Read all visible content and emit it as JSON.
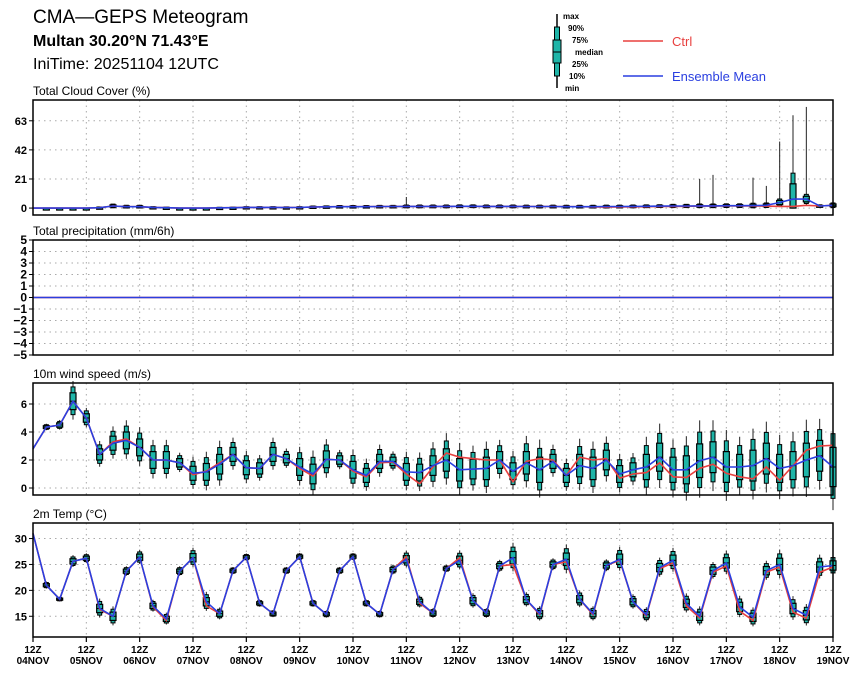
{
  "header": {
    "title": "CMA—GEPS Meteogram",
    "location": "Multan 30.20°N 71.43°E",
    "init_time": "IniTime: 20251104 12UTC"
  },
  "legend": {
    "box_labels": [
      "max",
      "90%",
      "75%",
      "median",
      "25%",
      "10%",
      "min"
    ],
    "ctrl_label": "Ctrl",
    "mean_label": "Ensemble Mean",
    "ctrl_color": "#e8403f",
    "mean_color": "#2a3fe0",
    "box_color": "#1fb5a8"
  },
  "chart_data": {
    "type": "line",
    "x_steps_hours": 6,
    "x_count": 61,
    "x_tick_labels": [
      [
        "12Z",
        "04NOV"
      ],
      [
        "12Z",
        "05NOV"
      ],
      [
        "12Z",
        "06NOV"
      ],
      [
        "12Z",
        "07NOV"
      ],
      [
        "12Z",
        "08NOV"
      ],
      [
        "12Z",
        "09NOV"
      ],
      [
        "12Z",
        "10NOV"
      ],
      [
        "12Z",
        "11NOV"
      ],
      [
        "12Z",
        "12NOV"
      ],
      [
        "12Z",
        "13NOV"
      ],
      [
        "12Z",
        "14NOV"
      ],
      [
        "12Z",
        "15NOV"
      ],
      [
        "12Z",
        "16NOV"
      ],
      [
        "12Z",
        "17NOV"
      ],
      [
        "12Z",
        "18NOV"
      ],
      [
        "12Z",
        "19NOV"
      ]
    ],
    "panels": [
      {
        "title": "Total Cloud Cover (%)",
        "ylim": [
          -5,
          78
        ],
        "yticks": [
          0,
          21,
          42,
          63
        ],
        "mean": [
          0,
          0,
          0,
          0,
          0,
          0.3,
          1.5,
          1,
          1,
          0.5,
          0.3,
          0,
          0,
          0,
          0.2,
          0.3,
          0.5,
          0.5,
          0.5,
          0.4,
          0.5,
          0.8,
          0.9,
          1,
          1,
          1,
          1.1,
          1.1,
          1.2,
          1.2,
          1.2,
          1.2,
          1.3,
          1.3,
          1.2,
          1.2,
          1.2,
          1.1,
          1.1,
          1.1,
          1,
          1,
          1,
          1.1,
          1.1,
          1.2,
          1.3,
          1.4,
          1.5,
          1.5,
          1.6,
          1.6,
          1.7,
          1.7,
          1.8,
          2,
          4,
          6.5,
          6.5,
          1.5,
          2
        ],
        "ctrl": [
          0,
          0,
          0,
          0,
          0,
          0.3,
          1.5,
          1,
          1,
          0.5,
          0.3,
          0,
          0,
          0,
          0.2,
          0.3,
          0.5,
          0.5,
          0.5,
          0.4,
          0.5,
          0.8,
          0.9,
          1,
          1,
          1,
          1.1,
          1.1,
          1.2,
          1.2,
          1.2,
          1.2,
          1.3,
          1.3,
          1.2,
          1.2,
          1.2,
          1.1,
          1.1,
          1.1,
          1,
          1,
          0.8,
          0.7,
          0.8,
          0.9,
          1,
          1.1,
          1.2,
          1.3,
          1.4,
          1.4,
          1.5,
          1.5,
          1.5,
          1.4,
          1.2,
          1.2,
          2,
          1.5,
          2
        ],
        "spread": [
          0,
          0,
          0,
          0,
          0,
          0.3,
          0.8,
          0.6,
          0.6,
          0.3,
          0.2,
          0,
          0,
          0,
          0.2,
          0.2,
          0.3,
          0.3,
          0.3,
          0.3,
          0.3,
          0.4,
          0.4,
          0.5,
          0.5,
          0.5,
          0.5,
          0.5,
          0.6,
          0.6,
          0.6,
          0.6,
          0.6,
          0.6,
          0.6,
          0.6,
          0.6,
          0.6,
          0.6,
          0.6,
          0.6,
          0.6,
          0.6,
          0.6,
          0.6,
          0.6,
          0.6,
          0.6,
          0.7,
          0.7,
          0.8,
          0.8,
          0.8,
          0.8,
          1,
          1,
          1.5,
          11,
          2,
          0.5,
          1
        ],
        "max": [
          0,
          0,
          0,
          0,
          0,
          0.5,
          2,
          1.5,
          1.5,
          0.8,
          0.5,
          0,
          0,
          0,
          0.4,
          0.5,
          0.8,
          0.8,
          0.8,
          0.7,
          0.8,
          1.2,
          1.3,
          1.5,
          1.5,
          1.5,
          1.6,
          1.6,
          8,
          1.8,
          1.8,
          1.8,
          1.9,
          1.9,
          1.8,
          1.8,
          1.8,
          1.7,
          1.7,
          1.7,
          1.6,
          1.6,
          1.6,
          1.7,
          1.7,
          1.8,
          1.9,
          2,
          2.2,
          2.2,
          21,
          24,
          2.5,
          2.5,
          22,
          16,
          48,
          67,
          73,
          2,
          3
        ]
      },
      {
        "title": "Total precipitation (mm/6h)",
        "ylim": [
          -5,
          5
        ],
        "yticks": [
          -5,
          -4,
          -3,
          -2,
          -1,
          0,
          1,
          2,
          3,
          4,
          5
        ],
        "mean": [
          0,
          0,
          0,
          0,
          0,
          0,
          0,
          0,
          0,
          0,
          0,
          0,
          0,
          0,
          0,
          0,
          0,
          0,
          0,
          0,
          0,
          0,
          0,
          0,
          0,
          0,
          0,
          0,
          0,
          0,
          0,
          0,
          0,
          0,
          0,
          0,
          0,
          0,
          0,
          0,
          0,
          0,
          0,
          0,
          0,
          0,
          0,
          0,
          0,
          0,
          0,
          0,
          0,
          0,
          0,
          0,
          0,
          0,
          0,
          0,
          0
        ],
        "ctrl": [
          0,
          0,
          0,
          0,
          0,
          0,
          0,
          0,
          0,
          0,
          0,
          0,
          0,
          0,
          0,
          0,
          0,
          0,
          0,
          0,
          0,
          0,
          0,
          0,
          0,
          0,
          0,
          0,
          0,
          0,
          0,
          0,
          0,
          0,
          0,
          0,
          0,
          0,
          0,
          0,
          0,
          0,
          0,
          0,
          0,
          0,
          0,
          0,
          0,
          0,
          0,
          0,
          0,
          0,
          0,
          0,
          0,
          0,
          0,
          0,
          0
        ]
      },
      {
        "title": "10m wind speed (m/s)",
        "ylim": [
          -0.5,
          7.5
        ],
        "yticks": [
          0,
          2,
          4,
          6
        ],
        "mean": [
          2.8,
          4.35,
          4.5,
          6.2,
          5.0,
          2.4,
          3.2,
          3.4,
          2.9,
          2.0,
          2.0,
          1.8,
          1.05,
          1.15,
          1.7,
          2.4,
          1.45,
          1.4,
          2.4,
          2.1,
          1.5,
          1.0,
          2.05,
          2.0,
          1.3,
          0.9,
          1.9,
          1.9,
          1.15,
          1.1,
          1.6,
          2.0,
          1.3,
          1.35,
          1.4,
          2.0,
          1.2,
          1.8,
          1.3,
          1.9,
          0.9,
          1.6,
          1.4,
          2.0,
          1.0,
          1.3,
          1.5,
          2.2,
          1.3,
          1.3,
          1.95,
          2.2,
          1.5,
          1.5,
          1.6,
          2.1,
          1.4,
          1.6,
          2.0,
          2.3,
          1.5
        ],
        "ctrl": [
          2.8,
          4.35,
          4.5,
          6.2,
          5.0,
          2.4,
          3.3,
          3.5,
          2.9,
          2.0,
          2.0,
          1.8,
          0.95,
          1.2,
          1.8,
          2.4,
          1.45,
          1.4,
          2.4,
          2.1,
          1.4,
          0.85,
          2.05,
          2.0,
          1.2,
          0.8,
          1.8,
          1.85,
          1.0,
          0.3,
          1.5,
          2.5,
          2.2,
          2.1,
          2.0,
          2.0,
          0.45,
          1.9,
          2.1,
          2.0,
          0.9,
          2.2,
          2.0,
          2.1,
          0.7,
          1.0,
          1.1,
          1.8,
          0.8,
          0.75,
          1.4,
          1.7,
          1.05,
          0.8,
          0.65,
          1.5,
          0.55,
          1.6,
          2.7,
          3.0,
          3.05
        ],
        "spread": [
          0,
          0.1,
          0.15,
          0.6,
          0.3,
          0.4,
          0.5,
          0.6,
          0.6,
          0.6,
          0.6,
          0.3,
          0.5,
          0.6,
          0.7,
          0.5,
          0.5,
          0.4,
          0.5,
          0.3,
          0.6,
          0.7,
          0.6,
          0.3,
          0.6,
          0.5,
          0.5,
          0.3,
          0.6,
          0.6,
          0.7,
          0.8,
          0.8,
          0.7,
          0.8,
          0.6,
          0.6,
          0.8,
          0.9,
          0.5,
          0.5,
          0.8,
          0.8,
          0.7,
          0.6,
          0.5,
          0.9,
          1.0,
          0.9,
          1.0,
          1.2,
          1.1,
          1.1,
          0.9,
          1.1,
          1.1,
          1.0,
          1.0,
          1.2,
          1.1,
          1.4
        ]
      },
      {
        "title": "2m Temp (°C)",
        "ylim": [
          11,
          33
        ],
        "yticks": [
          15,
          20,
          25,
          30
        ],
        "mean": [
          31,
          21,
          18.3,
          25.6,
          26.2,
          16.5,
          15,
          23.7,
          26.4,
          17,
          14.5,
          23.7,
          26.3,
          17.8,
          15.5,
          23.8,
          26.4,
          17.5,
          15.5,
          23.8,
          26.5,
          17.5,
          15.4,
          23.8,
          26.5,
          17.5,
          15.4,
          24,
          26,
          17.8,
          15.6,
          24.2,
          25.8,
          18,
          15.6,
          24.7,
          26.3,
          18.2,
          15.5,
          25,
          26,
          18.3,
          15.5,
          24.8,
          26,
          17.8,
          15.3,
          24.4,
          25.8,
          17.5,
          15,
          23.8,
          25.3,
          16.8,
          14.8,
          23.8,
          25,
          16.5,
          15.2,
          24.5,
          24.8
        ],
        "ctrl": [
          31,
          21,
          18.3,
          25.6,
          26.2,
          16.3,
          15,
          23.7,
          26.4,
          16.8,
          14.2,
          23.7,
          26.3,
          17.0,
          15.5,
          23.8,
          26.4,
          17.5,
          15.5,
          23.8,
          26.5,
          17.5,
          15.4,
          23.8,
          26.5,
          17.5,
          15.4,
          24,
          26.5,
          17.5,
          15.6,
          24.2,
          26.3,
          18,
          15.6,
          24.7,
          25.0,
          18.2,
          15.3,
          25,
          25.5,
          18.3,
          15.3,
          24.8,
          25.8,
          17.8,
          15.1,
          24.2,
          25.3,
          17.0,
          14.7,
          23.5,
          24.7,
          16.0,
          14.2,
          23.5,
          24.5,
          15.8,
          14.6,
          23.5,
          24.5
        ],
        "spread": [
          0,
          0.3,
          0.2,
          0.5,
          0.4,
          0.8,
          0.8,
          0.4,
          0.6,
          0.5,
          0.5,
          0.4,
          0.8,
          0.8,
          0.5,
          0.3,
          0.3,
          0.3,
          0.3,
          0.3,
          0.3,
          0.3,
          0.3,
          0.3,
          0.3,
          0.3,
          0.3,
          0.4,
          0.7,
          0.5,
          0.4,
          0.3,
          0.8,
          0.6,
          0.4,
          0.5,
          1.2,
          0.6,
          0.6,
          0.5,
          1.2,
          0.7,
          0.6,
          0.5,
          1.0,
          0.6,
          0.6,
          0.8,
          1.0,
          0.8,
          0.8,
          0.7,
          1.0,
          0.9,
          0.8,
          0.8,
          1.2,
          1.0,
          0.9,
          1.0,
          0.9
        ]
      }
    ]
  }
}
